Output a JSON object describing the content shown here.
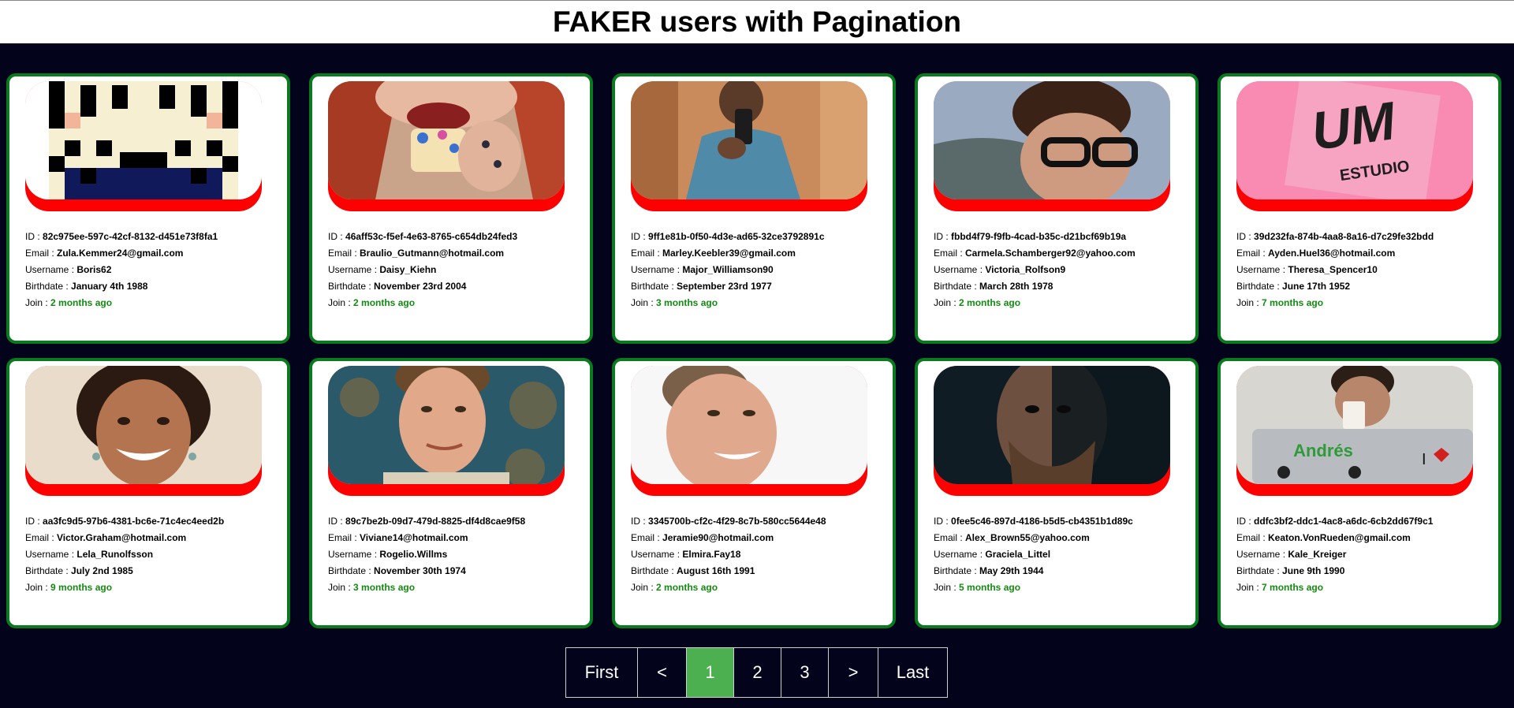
{
  "header": {
    "title": "FAKER users with Pagination"
  },
  "labels": {
    "id": "ID : ",
    "email": "Email : ",
    "username": "Username : ",
    "birthdate": "Birthdate : ",
    "join": "Join : "
  },
  "users": [
    {
      "id": "82c975ee-597c-42cf-8132-d451e73f8fa1",
      "email": "Zula.Kemmer24@gmail.com",
      "username": "Boris62",
      "birthdate": "January 4th 1988",
      "join": "2 months ago",
      "avatar": "pixel-art-avatar"
    },
    {
      "id": "46aff53c-f5ef-4e63-8765-c654db24fed3",
      "email": "Braulio_Gutmann@hotmail.com",
      "username": "Daisy_Kiehn",
      "birthdate": "November 23rd 2004",
      "join": "2 months ago",
      "avatar": "woman-eating-cake-photo"
    },
    {
      "id": "9ff1e81b-0f50-4d3e-ad65-32ce3792891c",
      "email": "Marley.Keebler39@gmail.com",
      "username": "Major_Williamson90",
      "birthdate": "September 23rd 1977",
      "join": "3 months ago",
      "avatar": "man-mirror-selfie-photo"
    },
    {
      "id": "fbbd4f79-f9fb-4cad-b35c-d21bcf69b19a",
      "email": "Carmela.Schamberger92@yahoo.com",
      "username": "Victoria_Rolfson9",
      "birthdate": "March 28th 1978",
      "join": "2 months ago",
      "avatar": "man-glasses-photo"
    },
    {
      "id": "39d232fa-874b-4aa8-8a16-d7c29fe32bdd",
      "email": "Ayden.Huel36@hotmail.com",
      "username": "Theresa_Spencer10",
      "birthdate": "June 17th 1952",
      "join": "7 months ago",
      "avatar": "um-estudio-logo",
      "logo_text": "UM",
      "logo_sub": "ESTUDIO"
    },
    {
      "id": "aa3fc9d5-97b6-4381-bc6e-71c4ec4eed2b",
      "email": "Victor.Graham@hotmail.com",
      "username": "Lela_Runolfsson",
      "birthdate": "July 2nd 1985",
      "join": "9 months ago",
      "avatar": "smiling-woman-photo"
    },
    {
      "id": "89c7be2b-09d7-479d-8825-df4d8cae9f58",
      "email": "Viviane14@hotmail.com",
      "username": "Rogelio.Willms",
      "birthdate": "November 30th 1974",
      "join": "3 months ago",
      "avatar": "young-man-photo"
    },
    {
      "id": "3345700b-cf2c-4f29-8c7b-580cc5644e48",
      "email": "Jeramie90@hotmail.com",
      "username": "Elmira.Fay18",
      "birthdate": "August 16th 1991",
      "join": "2 months ago",
      "avatar": "smiling-man-photo"
    },
    {
      "id": "0fee5c46-897d-4186-b5d5-cb4351b1d89c",
      "email": "Alex_Brown55@yahoo.com",
      "username": "Graciela_Littel",
      "birthdate": "May 29th 1944",
      "join": "5 months ago",
      "avatar": "bearded-man-photo"
    },
    {
      "id": "ddfc3bf2-ddc1-4ac8-a6dc-6cb2dd67f9c1",
      "email": "Keaton.VonRueden@gmail.com",
      "username": "Kale_Kreiger",
      "birthdate": "June 9th 1990",
      "join": "7 months ago",
      "avatar": "man-laptop-coffee-photo",
      "laptop_sticker": "Andrés"
    }
  ],
  "pagination": {
    "first": "First",
    "prev": "<",
    "pages": [
      "1",
      "2",
      "3"
    ],
    "active_page": "1",
    "next": ">",
    "last": "Last"
  },
  "colors": {
    "page_bg": "#03041c",
    "card_border": "#0a7a1e",
    "photo_underlay": "#ff0000",
    "join_text": "#138a12",
    "active_page_bg": "#4caf50"
  }
}
